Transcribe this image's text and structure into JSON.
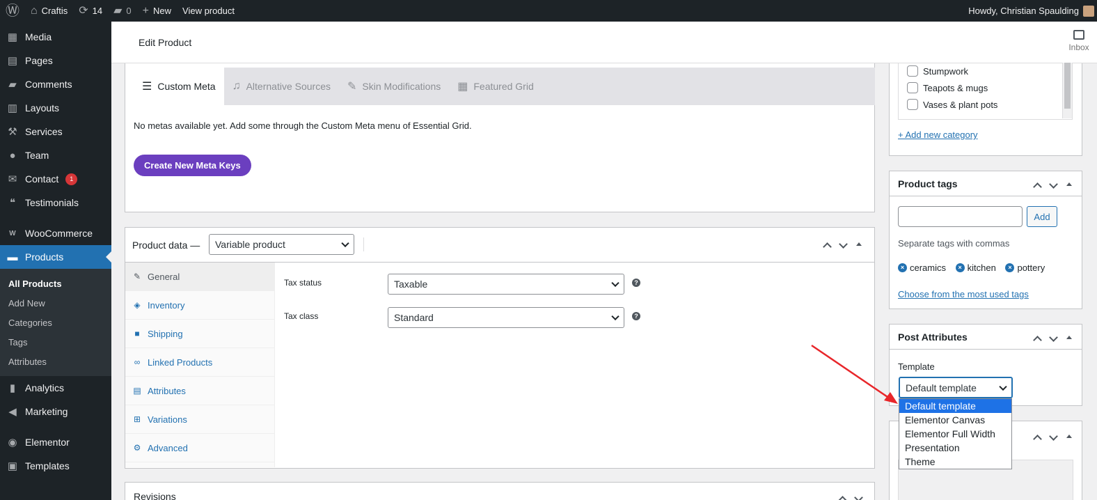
{
  "adminbar": {
    "site": "Craftis",
    "updates": "14",
    "comments": "0",
    "new": "New",
    "view": "View product",
    "howdy": "Howdy, Christian Spaulding"
  },
  "sidebar": {
    "items": [
      {
        "label": "Media",
        "icon": "media-icon"
      },
      {
        "label": "Pages",
        "icon": "pages-icon"
      },
      {
        "label": "Comments",
        "icon": "comments-icon"
      },
      {
        "label": "Layouts",
        "icon": "layouts-icon"
      },
      {
        "label": "Services",
        "icon": "services-icon"
      },
      {
        "label": "Team",
        "icon": "team-icon"
      },
      {
        "label": "Contact",
        "icon": "mail-icon",
        "badge": "1"
      },
      {
        "label": "Testimonials",
        "icon": "testimonials-icon"
      },
      {
        "label": "WooCommerce",
        "icon": "woo-icon"
      },
      {
        "label": "Products",
        "icon": "products-icon"
      },
      {
        "label": "Analytics",
        "icon": "analytics-icon"
      },
      {
        "label": "Marketing",
        "icon": "marketing-icon"
      },
      {
        "label": "Elementor",
        "icon": "elementor-icon"
      },
      {
        "label": "Templates",
        "icon": "templates-icon"
      }
    ],
    "submenu": [
      "All Products",
      "Add New",
      "Categories",
      "Tags",
      "Attributes"
    ]
  },
  "header": {
    "title": "Edit Product",
    "inbox": "Inbox"
  },
  "meta_box": {
    "tabs": [
      "Custom Meta",
      "Alternative Sources",
      "Skin Modifications",
      "Featured Grid"
    ],
    "message": "No metas available yet. Add some through the Custom Meta menu of Essential Grid.",
    "button": "Create New Meta Keys"
  },
  "product_data": {
    "title": "Product data —",
    "type": "Variable product",
    "tabs": [
      "General",
      "Inventory",
      "Shipping",
      "Linked Products",
      "Attributes",
      "Variations",
      "Advanced"
    ],
    "tax_status_label": "Tax status",
    "tax_status": "Taxable",
    "tax_class_label": "Tax class",
    "tax_class": "Standard"
  },
  "revisions": {
    "title": "Revisions"
  },
  "categories": {
    "items": [
      "Stumpwork",
      "Teapots & mugs",
      "Vases & plant pots"
    ],
    "add_new": "+ Add new category"
  },
  "product_tags": {
    "title": "Product tags",
    "add": "Add",
    "hint": "Separate tags with commas",
    "tags": [
      "ceramics",
      "kitchen",
      "pottery"
    ],
    "choose": "Choose from the most used tags"
  },
  "post_attributes": {
    "title": "Post Attributes",
    "template_label": "Template",
    "selected": "Default template",
    "options": [
      "Default template",
      "Elementor Canvas",
      "Elementor Full Width",
      "Presentation",
      "Theme"
    ]
  },
  "colors": {
    "accent": "#2271b1",
    "purple": "#6b3fbf",
    "annotation": "#e8262a"
  }
}
